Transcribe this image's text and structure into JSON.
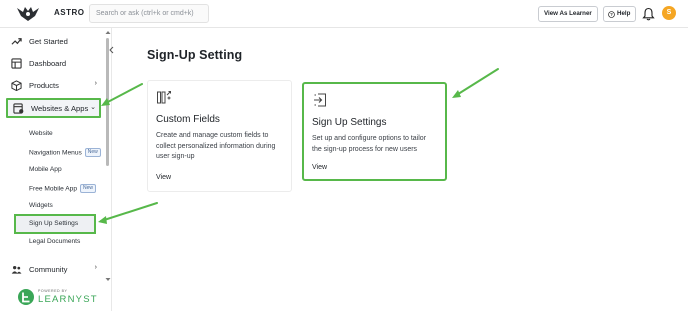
{
  "topbar": {
    "brand": "ASTRO",
    "search_placeholder": "Search or ask (ctrl+k or cmd+k)",
    "view_as_learner": "View As Learner",
    "help": "Help",
    "avatar_initial": "S",
    "avatar_color": "#f5a623"
  },
  "sidebar": {
    "items": [
      {
        "label": "Get Started",
        "icon": "trend-icon"
      },
      {
        "label": "Dashboard",
        "icon": "dashboard-icon"
      },
      {
        "label": "Products",
        "icon": "box-icon",
        "chevron": "›"
      },
      {
        "label": "Websites & Apps",
        "icon": "websites-icon",
        "chevron": "⌄"
      },
      {
        "label": "Community",
        "icon": "community-icon",
        "chevron": "›"
      }
    ],
    "sub_items": [
      {
        "label": "Website"
      },
      {
        "label": "Navigation Menus",
        "badge": "New"
      },
      {
        "label": "Mobile App"
      },
      {
        "label": "Free Mobile App",
        "badge": "New"
      },
      {
        "label": "Widgets"
      },
      {
        "label": "Sign Up Settings"
      },
      {
        "label": "Legal Documents"
      }
    ],
    "footer": {
      "powered_by": "POWERED BY",
      "name": "LEARNYST"
    }
  },
  "main": {
    "title": "Sign-Up Setting",
    "cards": [
      {
        "title": "Custom Fields",
        "desc_lines": [
          "Create and manage custom fields to",
          "collect personalized information during",
          "user sign-up"
        ],
        "link": "View"
      },
      {
        "title": "Sign Up Settings",
        "desc_lines": [
          "Set up and configure options to tailor",
          "the sign-up process for new users"
        ],
        "link": "View"
      }
    ]
  },
  "colors": {
    "highlight": "#57b84a",
    "arrow": "#57b84a",
    "brand_green": "#3aa657"
  }
}
